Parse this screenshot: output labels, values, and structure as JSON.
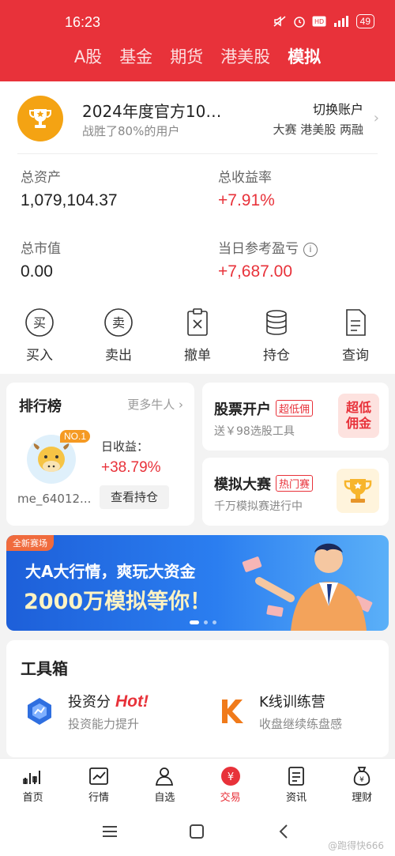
{
  "status": {
    "time": "16:23",
    "battery": "49"
  },
  "tabs": [
    {
      "label": "A股"
    },
    {
      "label": "基金"
    },
    {
      "label": "期货"
    },
    {
      "label": "港美股"
    },
    {
      "label": "模拟"
    }
  ],
  "account": {
    "contest_title": "2024年度官方10…",
    "contest_sub": "战胜了80%的用户",
    "switch_label": "切换账户",
    "switch_sub": "大赛 港美股 两融",
    "total_assets_label": "总资产",
    "total_assets": "1,079,104.37",
    "total_return_label": "总收益率",
    "total_return": "+7.91%",
    "market_value_label": "总市值",
    "market_value": "0.00",
    "daily_pnl_label": "当日参考盈亏",
    "daily_pnl": "+7,687.00"
  },
  "actions": [
    {
      "label": "买入",
      "icon": "buy-icon"
    },
    {
      "label": "卖出",
      "icon": "sell-icon"
    },
    {
      "label": "撤单",
      "icon": "cancel-order-icon"
    },
    {
      "label": "持仓",
      "icon": "holdings-icon"
    },
    {
      "label": "查询",
      "icon": "query-icon"
    }
  ],
  "ranking": {
    "title": "排行榜",
    "more": "更多牛人",
    "badge": "NO.1",
    "user": "me_64012...",
    "daily_label": "日收益：",
    "daily_value": "+38.79%",
    "button": "查看持仓"
  },
  "promo_open": {
    "title": "股票开户",
    "tag": "超低佣",
    "sub": "送￥98选股工具",
    "badge_l1": "超低",
    "badge_l2": "佣金"
  },
  "promo_contest": {
    "title": "模拟大赛",
    "tag": "热门赛",
    "sub": "千万模拟赛进行中"
  },
  "banner": {
    "tag": "全新赛场",
    "line1": "大A大行情，爽玩大资金",
    "line2": "2000万模拟等你！"
  },
  "toolbox": {
    "title": "工具箱",
    "item1_title": "投资分",
    "item1_hot": "Hot!",
    "item1_sub": "投资能力提升",
    "item2_title": "K线训练营",
    "item2_sub": "收盘继续练盘感"
  },
  "bottom_nav": [
    {
      "label": "首页"
    },
    {
      "label": "行情"
    },
    {
      "label": "自选"
    },
    {
      "label": "交易"
    },
    {
      "label": "资讯"
    },
    {
      "label": "理财"
    }
  ],
  "watermark": "@跑得快666",
  "colors": {
    "brand": "#e8323a",
    "gold": "#f4a313",
    "banner_blue": "#1d5fd9"
  }
}
